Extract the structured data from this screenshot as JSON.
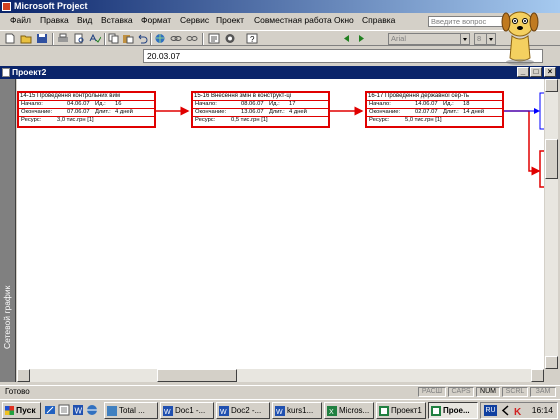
{
  "window": {
    "title": "Microsoft Project"
  },
  "menu": {
    "items": [
      "Файл",
      "Правка",
      "Вид",
      "Вставка",
      "Формат",
      "Сервис",
      "Проект",
      "Совместная работа",
      "Окно",
      "Справка"
    ],
    "help_placeholder": "Введите вопрос"
  },
  "toolbar": {
    "font_name": "Arial",
    "font_size": "8"
  },
  "entry": {
    "value": "20.03.07"
  },
  "document": {
    "title": "Проект2"
  },
  "view": {
    "label": "Сетевой график"
  },
  "tasks": [
    {
      "name": "14-15 Проведення контрольних вим",
      "start_label": "Начало:",
      "start": "04.06.07",
      "id_label": "Ид.:",
      "id": "16",
      "finish_label": "Окончание:",
      "finish": "07.06.07",
      "duration_label": "Длит.:",
      "duration": "4 дней",
      "resource_label": "Ресурс:",
      "resource": "3,0 тис.грн [1]"
    },
    {
      "name": "15-16 Внесення змін в конструкт-ці",
      "start_label": "Начало:",
      "start": "08.06.07",
      "id_label": "Ид.:",
      "id": "17",
      "finish_label": "Окончание:",
      "finish": "13.06.07",
      "duration_label": "Длит.:",
      "duration": "4 дней",
      "resource_label": "Ресурс:",
      "resource": "0,5 тис.грн [1]"
    },
    {
      "name": "16-17 Проведення державної сер-ть",
      "start_label": "Начало:",
      "start": "14.06.07",
      "id_label": "Ид.:",
      "id": "18",
      "finish_label": "Окончание:",
      "finish": "02.07.07",
      "duration_label": "Длит.:",
      "duration": "14 дней",
      "resource_label": "Ресурс:",
      "resource": "5,0 тис.грн [1]"
    }
  ],
  "status": {
    "text": "Готово",
    "indicators": [
      "РАСШ",
      "CAPS",
      "NUM",
      "SCRL",
      "ЗАМ"
    ]
  },
  "taskbar": {
    "start_label": "Пуск",
    "buttons": [
      "Total ...",
      "Doc1 -...",
      "Doc2 -...",
      "kurs1...",
      "Micros...",
      "Проект1",
      "Прое..."
    ],
    "lang": "RU",
    "clock": "16:14"
  },
  "colors": {
    "accent": "#0a246a",
    "task_border": "#e00000",
    "link_blue": "#0000ff"
  }
}
